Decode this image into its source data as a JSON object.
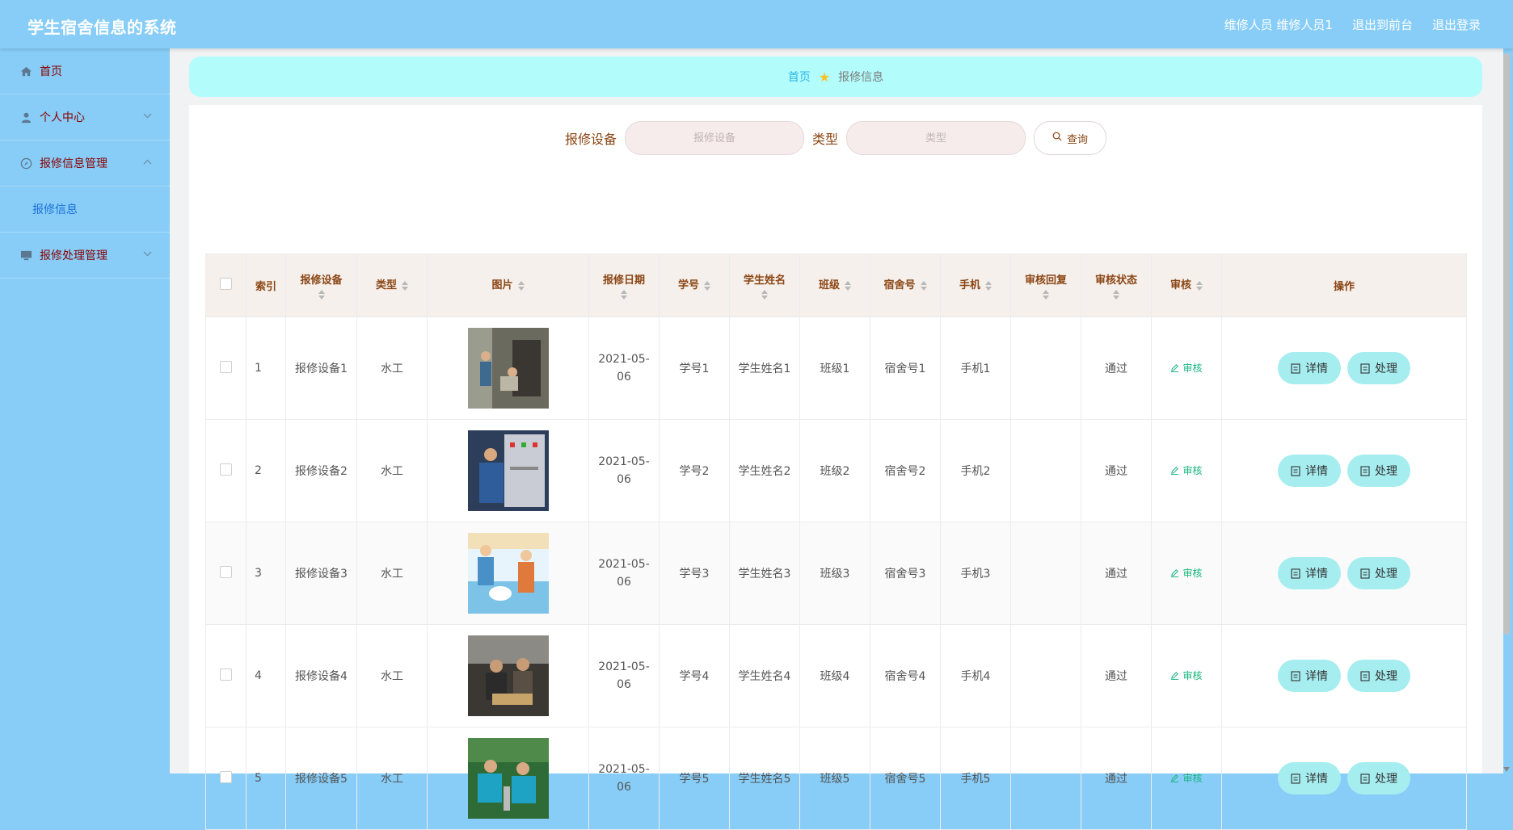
{
  "app": {
    "title": "学生宿舍信息的系统"
  },
  "header": {
    "user_role": "维修人员",
    "user_name": "维修人员1",
    "to_front_label": "退出到前台",
    "logout_label": "退出登录"
  },
  "sidebar": {
    "items": [
      {
        "label": "首页",
        "icon": "home-icon"
      },
      {
        "label": "个人中心",
        "icon": "user-icon"
      },
      {
        "label": "报修信息管理",
        "icon": "compass-icon"
      },
      {
        "label": "报修处理管理",
        "icon": "monitor-icon"
      }
    ],
    "sub_item": "报修信息"
  },
  "breadcrumb": {
    "home": "首页",
    "current": "报修信息"
  },
  "search": {
    "device_label": "报修设备",
    "device_placeholder": "报修设备",
    "type_label": "类型",
    "type_placeholder": "类型",
    "button_label": "查询"
  },
  "table": {
    "headers": {
      "index": "索引",
      "device": "报修设备",
      "type": "类型",
      "image": "图片",
      "date": "报修日期",
      "student_id": "学号",
      "student_name": "学生姓名",
      "class": "班级",
      "dorm": "宿舍号",
      "phone": "手机",
      "review_reply": "审核回复",
      "review_status": "审核状态",
      "review": "审核",
      "ops": "操作"
    },
    "review_link": "审核",
    "detail_label": "详情",
    "process_label": "处理",
    "rows": [
      {
        "index": "1",
        "device": "报修设备1",
        "type": "水工",
        "date_line1": "2021-05-",
        "date_line2": "06",
        "student_id": "学号1",
        "student_name": "学生姓名1",
        "class": "班级1",
        "dorm": "宿舍号1",
        "phone": "手机1",
        "review_reply": "",
        "review_status": "通过"
      },
      {
        "index": "2",
        "device": "报修设备2",
        "type": "水工",
        "date_line1": "2021-05-",
        "date_line2": "06",
        "student_id": "学号2",
        "student_name": "学生姓名2",
        "class": "班级2",
        "dorm": "宿舍号2",
        "phone": "手机2",
        "review_reply": "",
        "review_status": "通过"
      },
      {
        "index": "3",
        "device": "报修设备3",
        "type": "水工",
        "date_line1": "2021-05-",
        "date_line2": "06",
        "student_id": "学号3",
        "student_name": "学生姓名3",
        "class": "班级3",
        "dorm": "宿舍号3",
        "phone": "手机3",
        "review_reply": "",
        "review_status": "通过"
      },
      {
        "index": "4",
        "device": "报修设备4",
        "type": "水工",
        "date_line1": "2021-05-",
        "date_line2": "06",
        "student_id": "学号4",
        "student_name": "学生姓名4",
        "class": "班级4",
        "dorm": "宿舍号4",
        "phone": "手机4",
        "review_reply": "",
        "review_status": "通过"
      },
      {
        "index": "5",
        "device": "报修设备5",
        "type": "水工",
        "date_line1": "2021-05-",
        "date_line2": "06",
        "student_id": "学号5",
        "student_name": "学生姓名5",
        "class": "班级5",
        "dorm": "宿舍号5",
        "phone": "手机5",
        "review_reply": "",
        "review_status": "通过"
      }
    ]
  },
  "colors": {
    "header_bg": "#87cdf7",
    "breadcrumb_bg": "#b3fcfc",
    "button_bg": "#a6edf0",
    "menu_text": "#8b0000",
    "accent_label": "#8b4513",
    "review_link": "#16b67e"
  }
}
